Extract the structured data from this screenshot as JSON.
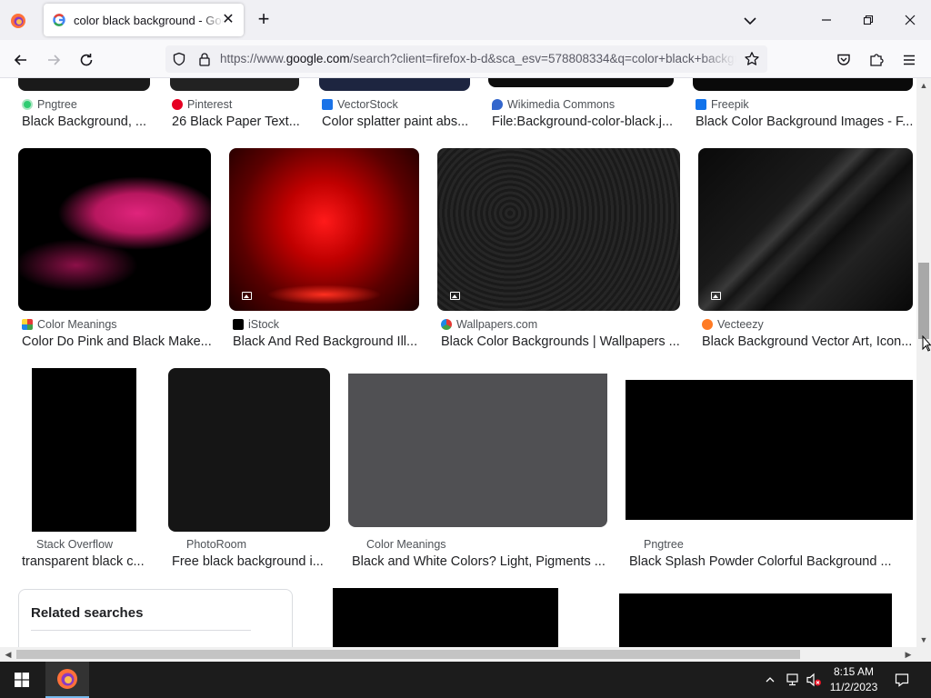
{
  "browser": {
    "tab_title": "color black background - Google",
    "url_prefix": "https://www.",
    "url_domain": "google.com",
    "url_rest": "/search?client=firefox-b-d&sca_esv=578808334&q=color+black+background"
  },
  "results": {
    "row1": [
      {
        "source": "Pngtree",
        "title": "Black Background, ..."
      },
      {
        "source": "Pinterest",
        "title": "26 Black Paper Text..."
      },
      {
        "source": "VectorStock",
        "title": "Color splatter paint abs..."
      },
      {
        "source": "Wikimedia Commons",
        "title": "File:Background-color-black.j..."
      },
      {
        "source": "Freepik",
        "title": "Black Color Background Images - F..."
      }
    ],
    "row2": [
      {
        "source": "Color Meanings",
        "title": "Color Do Pink and Black Make..."
      },
      {
        "source": "iStock",
        "title": "Black And Red Background Ill..."
      },
      {
        "source": "Wallpapers.com",
        "title": "Black Color Backgrounds | Wallpapers ..."
      },
      {
        "source": "Vecteezy",
        "title": "Black Background Vector Art, Icon..."
      }
    ],
    "row3": [
      {
        "source": "Stack Overflow",
        "title": "transparent black c..."
      },
      {
        "source": "PhotoRoom",
        "title": "Free black background i..."
      },
      {
        "source": "Color Meanings",
        "title": "Black and White Colors? Light, Pigments ..."
      },
      {
        "source": "Pngtree",
        "title": "Black Splash Powder Colorful Background ..."
      }
    ]
  },
  "related": {
    "title": "Related searches"
  },
  "taskbar": {
    "time": "8:15 AM",
    "date": "11/2/2023"
  },
  "colors": {
    "accent": "#76b9ed",
    "page_bg": "#ffffff",
    "text": "#202124",
    "meta": "#4d5156"
  }
}
